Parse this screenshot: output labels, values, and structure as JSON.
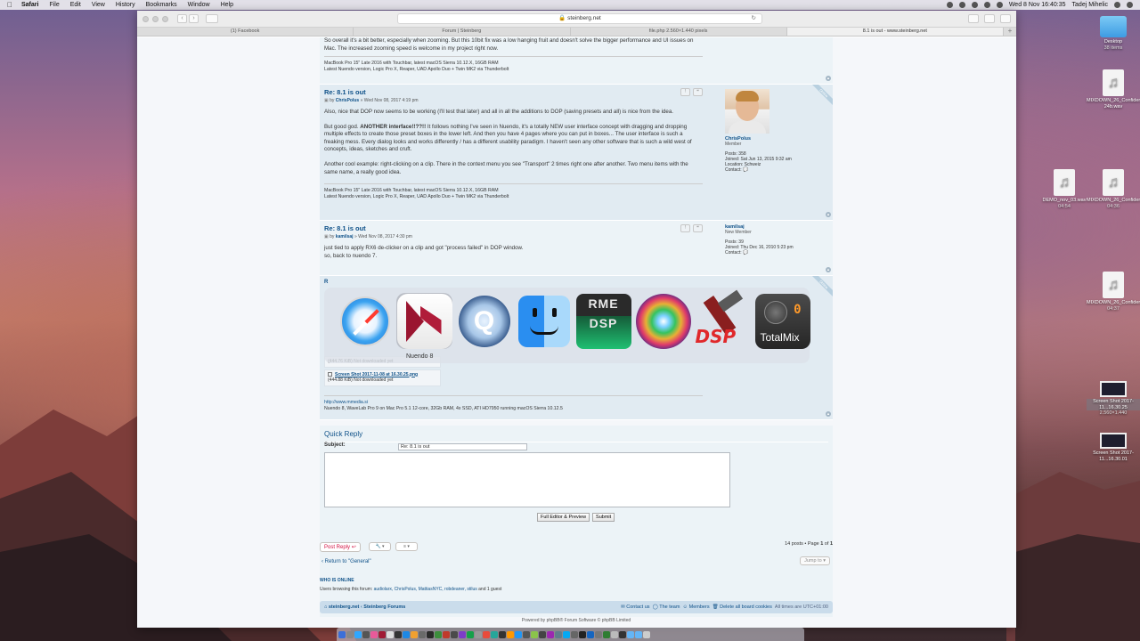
{
  "menubar": {
    "apple": "",
    "items": [
      "Safari",
      "File",
      "Edit",
      "View",
      "History",
      "Bookmarks",
      "Window",
      "Help"
    ],
    "clock": "Wed 8 Nov  16:40:35",
    "user": "Tadej Mihelic"
  },
  "browser": {
    "url": "steinberg.net",
    "tabs": [
      "(1) Facebook",
      "Forum | Steinberg",
      "file.php 2.560×1.440 pixels",
      "8.1 is out - www.steinberg.net"
    ]
  },
  "top_fragment": {
    "text": "So overall it's a bit better, especially when zooming. But this 10bit fix was a low hanging fruit and doesn't solve the bigger performance and UI issues on Mac. The increased zooming speed is welcome in my project right now.",
    "sig1": "MacBook Pro 15\" Late 2016 with Touchbar, latest macOS Sierra 10.12.X, 16GB RAM",
    "sig2": "Latest Nuendo version, Logic Pro X, Reaper, UAD Apollo Duo + Twin MK2 via Thunderbolt"
  },
  "posts": [
    {
      "title": "Re: 8.1 is out",
      "by": "by",
      "author": "ChrisPolus",
      "date": "» Wed Nov 08, 2017 4:19 pm",
      "online": "Online",
      "p1": "Also, nice that DOP now seems to be working (I'll test that later) and all in all the additions to DOP (saving presets and all) is nice from the idea.",
      "p2a": "But good god. ",
      "p2b": "ANOTHER interface!!??!!",
      "p2c": " It follows nothing I've seen in Nuendo, it's a totally NEW user interface concept with dragging and dropping multiple effects to create those preset boxes in the lower left. And then you have 4 pages where you can put in boxes... The user interface is such a freaking mess. Every dialog looks and works differently / has a different usability paradigm. I haven't seen any other software that is such a wild west of concepts, ideas, sketches and cruft.",
      "p3": "Another cool example: right-clicking on a clip. There in the context menu you see \"Transport\" 2 times right one after another. Two menu items with the same name, a really good idea.",
      "sig1": "MacBook Pro 15\" Late 2016 with Touchbar, latest macOS Sierra 10.12.X, 16GB RAM",
      "sig2": "Latest Nuendo version, Logic Pro X, Reaper, UAD Apollo Duo + Twin MK2 via Thunderbolt",
      "profile": {
        "name": "ChrisPolus",
        "rank": "Member",
        "posts": "Posts: 358",
        "joined": "Joined: Sat Jun 13, 2015 9:32 am",
        "location": "Location: Schweiz",
        "contact": "Contact:"
      }
    },
    {
      "title": "Re: 8.1 is out",
      "by": "by",
      "author": "kamilsaj",
      "date": "» Wed Nov 08, 2017 4:30 pm",
      "p1": "just tied to apply RX6 de-clicker on a clip and got \"process failed\" in DOP window.",
      "p2": "so, back to nuendo 7.",
      "profile": {
        "name": "kamilsaj",
        "rank": "New Member",
        "posts": "Posts: 39",
        "joined": "Joined: Thu Dec 16, 2010 5:23 pm",
        "contact": "Contact:"
      }
    },
    {
      "fragment_letter": "R",
      "online": "Online",
      "attach1_size": "(444.76 KiB) Not downloaded yet",
      "attach2_name": "Screen Shot 2017-11-08 at 16.30.25.png",
      "attach2_size": "(444.88 KiB) Not downloaded yet",
      "sig_link": "http://www.mmedia.si",
      "sig_text": "Nuendo 8, WaveLab Pro 9 on Mac Pro 5.1 12-core, 32Gb RAM, 4x SSD, ATI HD7950 running macOS Sierra 10.12.5"
    }
  ],
  "app_switcher": {
    "selected_label": "Nuendo 8",
    "apps": [
      "safari-icon",
      "nuendo-icon",
      "quicktime-icon",
      "finder-icon",
      "rme-digicheck-icon",
      "iris-icon",
      "dsp-icon",
      "totalmix-icon"
    ],
    "rme_text_1": "RME",
    "rme_text_2": "DSP",
    "dsp_text": "DSP",
    "totalmix_zero": "0",
    "totalmix_text": "TotalMix"
  },
  "quick_reply": {
    "title": "Quick Reply",
    "subject_label": "Subject:",
    "subject_value": "Re: 8.1 is out",
    "full_editor": "Full Editor & Preview",
    "submit": "Submit"
  },
  "actions": {
    "post_reply": "Post Reply",
    "pagination_prefix": "14 posts • Page ",
    "page": "1",
    "of": " of ",
    "pages": "1",
    "return": "Return to \"General\"",
    "jump_to": "Jump to"
  },
  "online": {
    "heading": "WHO IS ONLINE",
    "prefix": "Users browsing this forum: ",
    "users": "audiolarx, ChrisPolus, MattiasNYC, robdeaner, stilus",
    "suffix": " and 1 guest"
  },
  "footer": {
    "crumb1": "steinberg.net",
    "crumb2": "Steinberg Forums",
    "contact": "Contact us",
    "team": "The team",
    "members": "Members",
    "delete": "Delete all board cookies",
    "tz": "All times are UTC+01:00",
    "powered": "Powered by phpBB® Forum Software © phpBB Limited"
  },
  "desktop": {
    "items": [
      {
        "name": "Desktop",
        "sub": "38 items"
      },
      {
        "name": "MIXDOWN_26_Confidenza-24b.wav",
        "sub": ""
      },
      {
        "name": "DEMO_nov_03.wav",
        "sub": "04:54"
      },
      {
        "name": "MIXDOWN_26_Confidenza.wav",
        "sub": "04:36"
      },
      {
        "name": "MIXDOWN_26_Confidenza.wav",
        "sub": "04:37"
      },
      {
        "name": "Screen Shot 2017-11...16.30.25",
        "sub": "2.560×1.440"
      },
      {
        "name": "Screen Shot 2017-11...16.30.01",
        "sub": ""
      }
    ]
  }
}
